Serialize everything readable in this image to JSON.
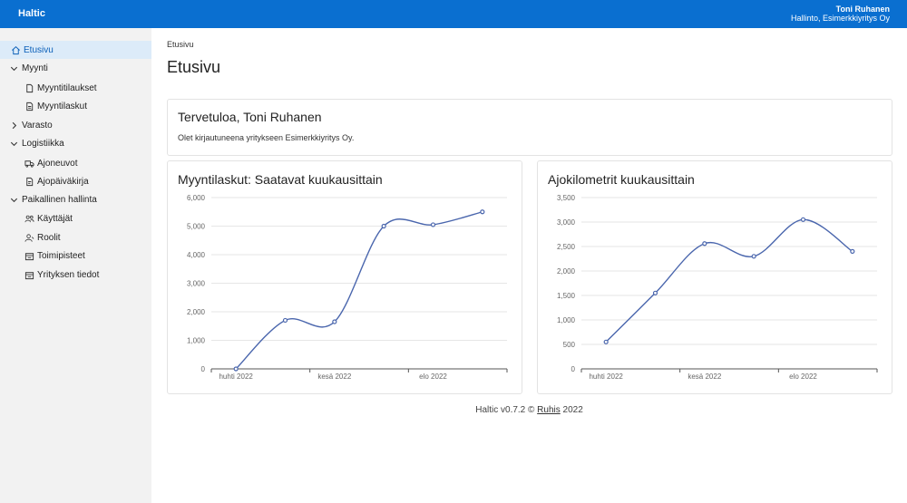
{
  "app": {
    "brand": "Haltic"
  },
  "user": {
    "name": "Toni Ruhanen",
    "org": "Hallinto, Esimerkkiyritys Oy"
  },
  "sidebar": {
    "items": [
      {
        "label": "Etusivu",
        "icon": "home-icon",
        "active": true
      },
      {
        "label": "Myynti",
        "icon": "chevron-down-icon"
      },
      {
        "label": "Myyntitilaukset",
        "icon": "document-icon"
      },
      {
        "label": "Myyntilaskut",
        "icon": "invoice-icon"
      },
      {
        "label": "Varasto",
        "icon": "chevron-right-icon"
      },
      {
        "label": "Logistiikka",
        "icon": "chevron-down-icon"
      },
      {
        "label": "Ajoneuvot",
        "icon": "truck-icon"
      },
      {
        "label": "Ajopäiväkirja",
        "icon": "logbook-icon"
      },
      {
        "label": "Paikallinen hallinta",
        "icon": "chevron-down-icon"
      },
      {
        "label": "Käyttäjät",
        "icon": "users-icon"
      },
      {
        "label": "Roolit",
        "icon": "roles-icon"
      },
      {
        "label": "Toimipisteet",
        "icon": "building-icon"
      },
      {
        "label": "Yrityksen tiedot",
        "icon": "company-icon"
      }
    ]
  },
  "breadcrumb": "Etusivu",
  "page_title": "Etusivu",
  "welcome": {
    "title": "Tervetuloa, Toni Ruhanen",
    "text": "Olet kirjautuneena yritykseen Esimerkkiyritys Oy."
  },
  "colors": {
    "accent": "#0a6fd0",
    "line": "#4a66ad"
  },
  "chart_data": [
    {
      "type": "line",
      "title": "Myyntilaskut: Saatavat kuukausittain",
      "x": [
        "2022-04",
        "2022-05",
        "2022-06",
        "2022-07",
        "2022-08",
        "2022-09"
      ],
      "values": [
        0,
        1700,
        1650,
        5000,
        5050,
        5500
      ],
      "ylim": [
        0,
        6000
      ],
      "yticks": [
        "0",
        "1,000",
        "2,000",
        "3,000",
        "4,000",
        "5,000",
        "6,000"
      ],
      "xticks": [
        "huhti 2022",
        "kesä 2022",
        "elo 2022"
      ],
      "grid": true
    },
    {
      "type": "line",
      "title": "Ajokilometrit kuukausittain",
      "x": [
        "2022-04",
        "2022-05",
        "2022-06",
        "2022-07",
        "2022-08",
        "2022-09"
      ],
      "values": [
        550,
        1550,
        2560,
        2300,
        3050,
        2400
      ],
      "ylim": [
        0,
        3500
      ],
      "yticks": [
        "0",
        "500",
        "1,000",
        "1,500",
        "2,000",
        "2,500",
        "3,000",
        "3,500"
      ],
      "xticks": [
        "huhti 2022",
        "kesä 2022",
        "elo 2022"
      ],
      "grid": true
    }
  ],
  "footer": {
    "prefix": "Haltic v0.7.2 © ",
    "link": "Ruhis",
    "suffix": " 2022"
  }
}
